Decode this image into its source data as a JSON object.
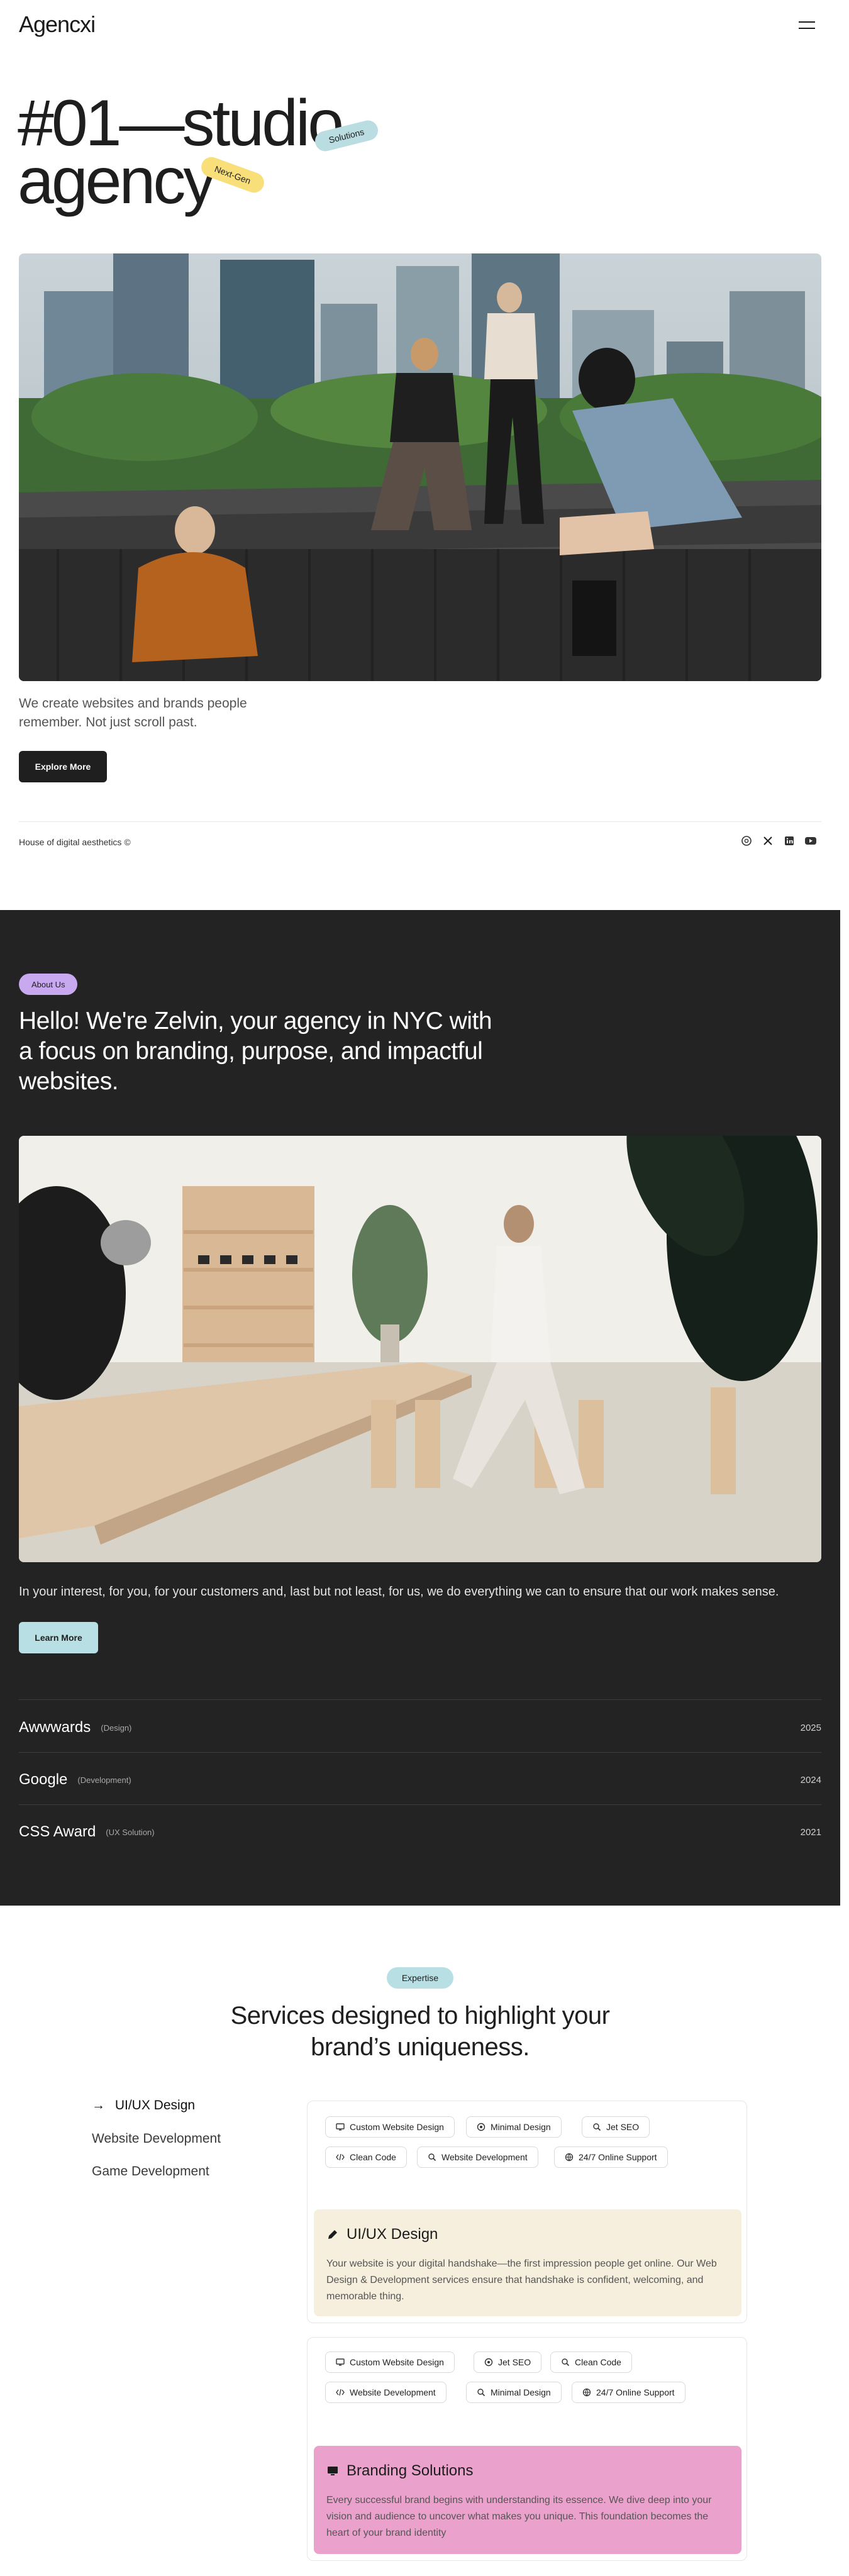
{
  "header": {
    "logo": "Agencxi"
  },
  "hero": {
    "title_line1": "#01—studio",
    "title_line2": "agency",
    "badge_solutions": "Solutions",
    "badge_nextgen": "Next-Gen",
    "description": "We create websites and brands people remember. Not just scroll past.",
    "button_label": "Explore More",
    "footer_text": "House of digital aesthetics ©",
    "social_icons": [
      "threads-icon",
      "x-icon",
      "linkedin-icon",
      "youtube-icon"
    ]
  },
  "about": {
    "badge": "About Us",
    "title": "Hello! We're Zelvin, your agency in NYC with a focus on branding, purpose, and impactful websites.",
    "description": "In your interest, for you, for your customers and, last but not least, for us, we do everything we can to ensure that our work makes sense.",
    "button_label": "Learn More",
    "awards": [
      {
        "name": "Awwwards",
        "tag": "(Design)",
        "year": "2025"
      },
      {
        "name": "Google",
        "tag": "(Development)",
        "year": "2024"
      },
      {
        "name": "CSS Award",
        "tag": "(UX Solution)",
        "year": "2021"
      }
    ]
  },
  "services": {
    "badge": "Expertise",
    "title": "Services designed to highlight your brand’s uniqueness.",
    "nav_arrow": "→",
    "nav": [
      "UI/UX Design",
      "Website Development",
      "Game Development"
    ],
    "cards": [
      {
        "chips_row1": [
          "Custom Website Design",
          "Minimal Design",
          "Jet SEO"
        ],
        "chips_row2": [
          "Clean Code",
          "Website Development",
          "24/7 Online Support"
        ],
        "title": "UI/UX Design",
        "body": "Your website is your digital handshake—the first impression people get online. Our Web Design & Development services ensure that handshake is confident, welcoming, and memorable thing.",
        "bg": "#f6efdd"
      },
      {
        "chips_row1": [
          "Custom Website Design",
          "Jet SEO",
          "Clean Code"
        ],
        "chips_row2": [
          "Website Development",
          "Minimal Design",
          "24/7 Online Support"
        ],
        "title": "Branding Solutions",
        "body": "Every successful brand begins with understanding its essence. We dive deep into your vision and audience to uncover what makes you unique. This foundation becomes the heart of your brand identity",
        "bg": "#eaa2cc"
      }
    ]
  }
}
